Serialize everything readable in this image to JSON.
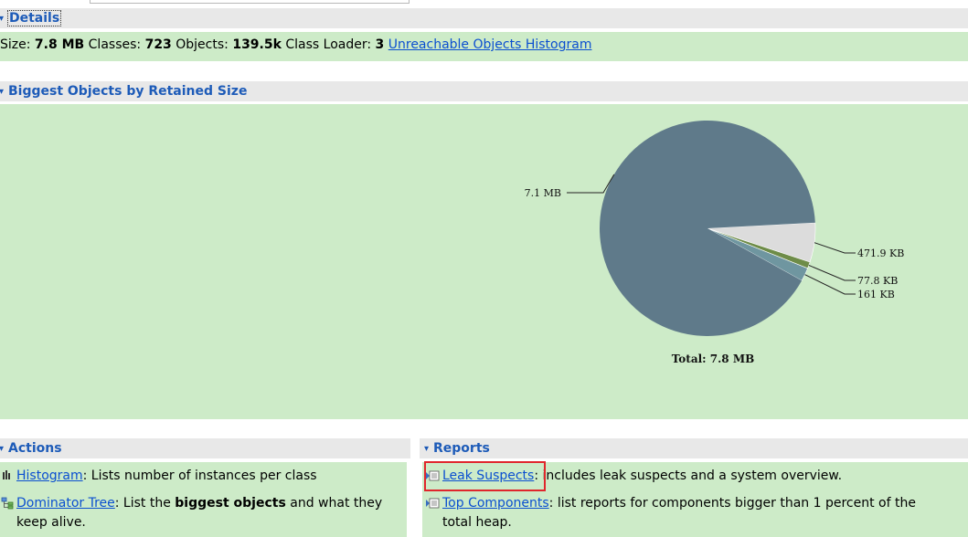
{
  "details": {
    "title": "Details",
    "size_label": "Size:",
    "size_value": "7.8 MB",
    "classes_label": "Classes:",
    "classes_value": "723",
    "objects_label": "Objects:",
    "objects_value": "139.5k",
    "loader_label": "Class Loader:",
    "loader_value": "3",
    "histogram_link": "Unreachable Objects Histogram"
  },
  "biggest": {
    "title": "Biggest Objects by Retained Size",
    "chart_data": {
      "type": "pie",
      "slices": [
        {
          "label": "7.1 MB",
          "value": 7.1,
          "unit": "MB",
          "color": "#5f7a8a"
        },
        {
          "label": "471.9 KB",
          "value": 471.9,
          "unit": "KB",
          "color": "#dcdcdc"
        },
        {
          "label": "77.8 KB",
          "value": 77.8,
          "unit": "KB",
          "color": "#6e8c48"
        },
        {
          "label": "161 KB",
          "value": 161,
          "unit": "KB",
          "color": "#6f96a0"
        }
      ],
      "total_label": "Total: 7.8 MB"
    }
  },
  "actions": {
    "title": "Actions",
    "items": [
      {
        "link": "Histogram",
        "text": ": Lists number of instances per class",
        "icon": "histogram-icon"
      },
      {
        "link": "Dominator Tree",
        "text_before": ": List the ",
        "bold": "biggest objects",
        "text_after": " and what they",
        "line2": "keep alive.",
        "icon": "dominator-tree-icon"
      }
    ]
  },
  "reports": {
    "title": "Reports",
    "items": [
      {
        "link": "Leak Suspects",
        "text": ": includes leak suspects and a system overview.",
        "icon": "report-icon"
      },
      {
        "link": "Top Components",
        "text": ": list reports for components bigger than 1 percent of the",
        "line2": "total heap.",
        "icon": "report-icon"
      }
    ]
  },
  "colors": {
    "section_bg": "#cdebc8",
    "header_bg": "#e8e8e8",
    "title_color": "#1d5bb8",
    "link_color": "#0b4fd0",
    "highlight": "#e0262c"
  }
}
